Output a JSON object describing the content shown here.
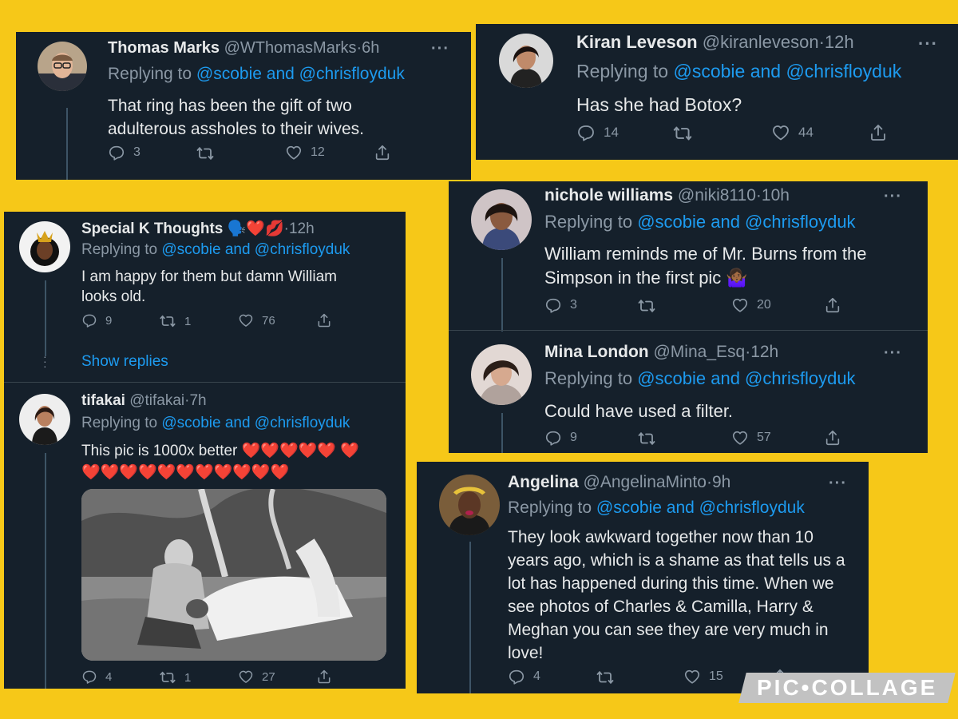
{
  "brand": {
    "watermark": "PIC•COLLAGE",
    "background": "#f6c818"
  },
  "colors": {
    "card_bg": "#15202b",
    "link": "#1d9bf0",
    "muted": "#8b98a5",
    "text": "#e7e9ea"
  },
  "icons": {
    "reply": "reply-icon",
    "retweet": "retweet-icon",
    "like": "heart-icon",
    "share": "share-icon",
    "more": "more-icon"
  },
  "tweets": {
    "thomas": {
      "name": "Thomas Marks",
      "handle": "@WThomasMarks",
      "time": "6h",
      "replying": "Replying to",
      "mentions": "@scobie and @chrisfloyduk",
      "text": "That ring has been the gift of two adulterous assholes to their wives.",
      "replies": "3",
      "retweets": "",
      "likes": "12"
    },
    "kiran": {
      "name": "Kiran Leveson",
      "handle": "@kiranleveson",
      "time": "12h",
      "replying": "Replying to",
      "mentions": "@scobie and @chrisfloyduk",
      "text": "Has she had Botox?",
      "replies": "14",
      "retweets": "",
      "likes": "44"
    },
    "specialk": {
      "name": "Special K Thoughts 🗣️❤️💋",
      "time": "12h",
      "replying": "Replying to",
      "mentions": "@scobie and @chrisfloyduk",
      "text": "I am happy for them but damn William looks old.",
      "replies": "9",
      "retweets": "1",
      "likes": "76"
    },
    "show_replies": "Show replies",
    "tifakai": {
      "name": "tifakai",
      "handle": "@tifakai",
      "time": "7h",
      "replying": "Replying to",
      "mentions": "@scobie and @chrisfloyduk",
      "text": "This pic is 1000x better ❤️❤️❤️❤️❤️ ❤️❤️❤️❤️❤️❤️❤️❤️❤️❤️❤️❤️",
      "replies": "4",
      "retweets": "1",
      "likes": "27"
    },
    "nichole": {
      "name": "nichole williams",
      "handle": "@niki8110",
      "time": "10h",
      "replying": "Replying to",
      "mentions": "@scobie and @chrisfloyduk",
      "text": "William reminds me of Mr. Burns from the Simpson in the first pic 🤷🏾‍♀️",
      "replies": "3",
      "retweets": "",
      "likes": "20"
    },
    "mina": {
      "name": "Mina London",
      "handle": "@Mina_Esq",
      "time": "12h",
      "replying": "Replying to",
      "mentions": "@scobie and @chrisfloyduk",
      "text": "Could have used a filter.",
      "replies": "9",
      "retweets": "",
      "likes": "57"
    },
    "angelina": {
      "name": "Angelina",
      "handle": "@AngelinaMinto",
      "time": "9h",
      "replying": "Replying to",
      "mentions": "@scobie and @chrisfloyduk",
      "text": "They look awkward together now than 10 years ago, which is a shame as that tells us a lot has happened during this time. When we see photos of Charles & Camilla, Harry & Meghan you can see they are very much in love!",
      "replies": "4",
      "retweets": "",
      "likes": "15"
    }
  }
}
